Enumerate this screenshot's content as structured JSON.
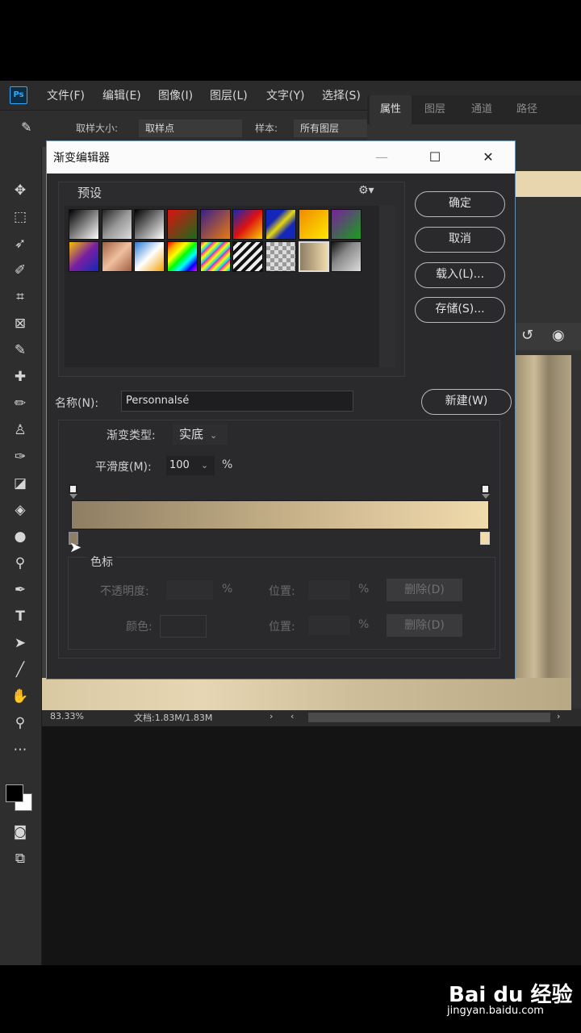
{
  "app": {
    "logo": "Ps"
  },
  "menu": [
    "文件(F)",
    "编辑(E)",
    "图像(I)",
    "图层(L)",
    "文字(Y)",
    "选择(S)"
  ],
  "options_bar": {
    "sample_size_label": "取样大小:",
    "sample_size_value": "取样点",
    "sample_label": "样本:",
    "sample_value": "所有图层"
  },
  "right_panel": {
    "tabs": [
      "属性",
      "图层",
      "通道",
      "路径"
    ]
  },
  "dialog": {
    "title": "渐变编辑器",
    "presets_label": "预设",
    "buttons": {
      "ok": "确定",
      "cancel": "取消",
      "load": "载入(L)...",
      "save": "存储(S)...",
      "new": "新建(W)"
    },
    "name_label": "名称(N):",
    "name_value": "Personnalsé",
    "type_label": "渐变类型:",
    "type_value": "实底",
    "smoothness_label": "平滑度(M):",
    "smoothness_value": "100",
    "percent": "%",
    "gradient_colors": {
      "start": "#8e7e63",
      "end": "#f0dbac"
    },
    "stops_section": {
      "title": "色标",
      "opacity_label": "不透明度:",
      "position_label": "位置:",
      "delete_label": "删除(D)",
      "color_label": "颜色:"
    }
  },
  "status": {
    "zoom": "83.33%",
    "doc": "文档:1.83M/1.83M"
  },
  "watermark": {
    "logo": "Bai du 经验",
    "url": "jingyan.baidu.com"
  }
}
